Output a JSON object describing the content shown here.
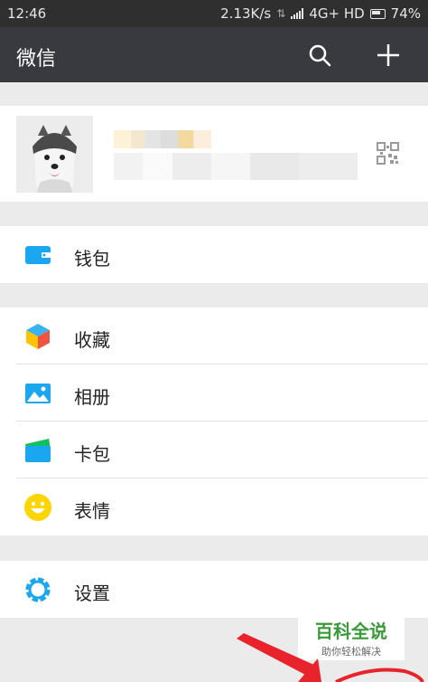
{
  "status_bar": {
    "time": "12:46",
    "network_speed": "2.13K/s",
    "network_type": "4G+ HD",
    "battery": "74%"
  },
  "header": {
    "title": "微信",
    "icons": [
      "search-icon",
      "plus-icon"
    ]
  },
  "profile": {
    "avatar": "husky-dog-avatar",
    "icons": [
      "qr-code-icon"
    ]
  },
  "menu": {
    "wallet": "钱包",
    "favorites": "收藏",
    "album": "相册",
    "cards": "卡包",
    "stickers": "表情",
    "settings": "设置"
  },
  "watermark": {
    "title": "百科全说",
    "subtitle": "助你轻松解决"
  },
  "colors": {
    "header_bg": "#393a3f",
    "status_bg": "#2f2f2f",
    "page_bg": "#ebebeb",
    "accent_blue": "#1aa7f0",
    "emoji_yellow": "#ffd500",
    "arrow_red": "#e8232b"
  }
}
